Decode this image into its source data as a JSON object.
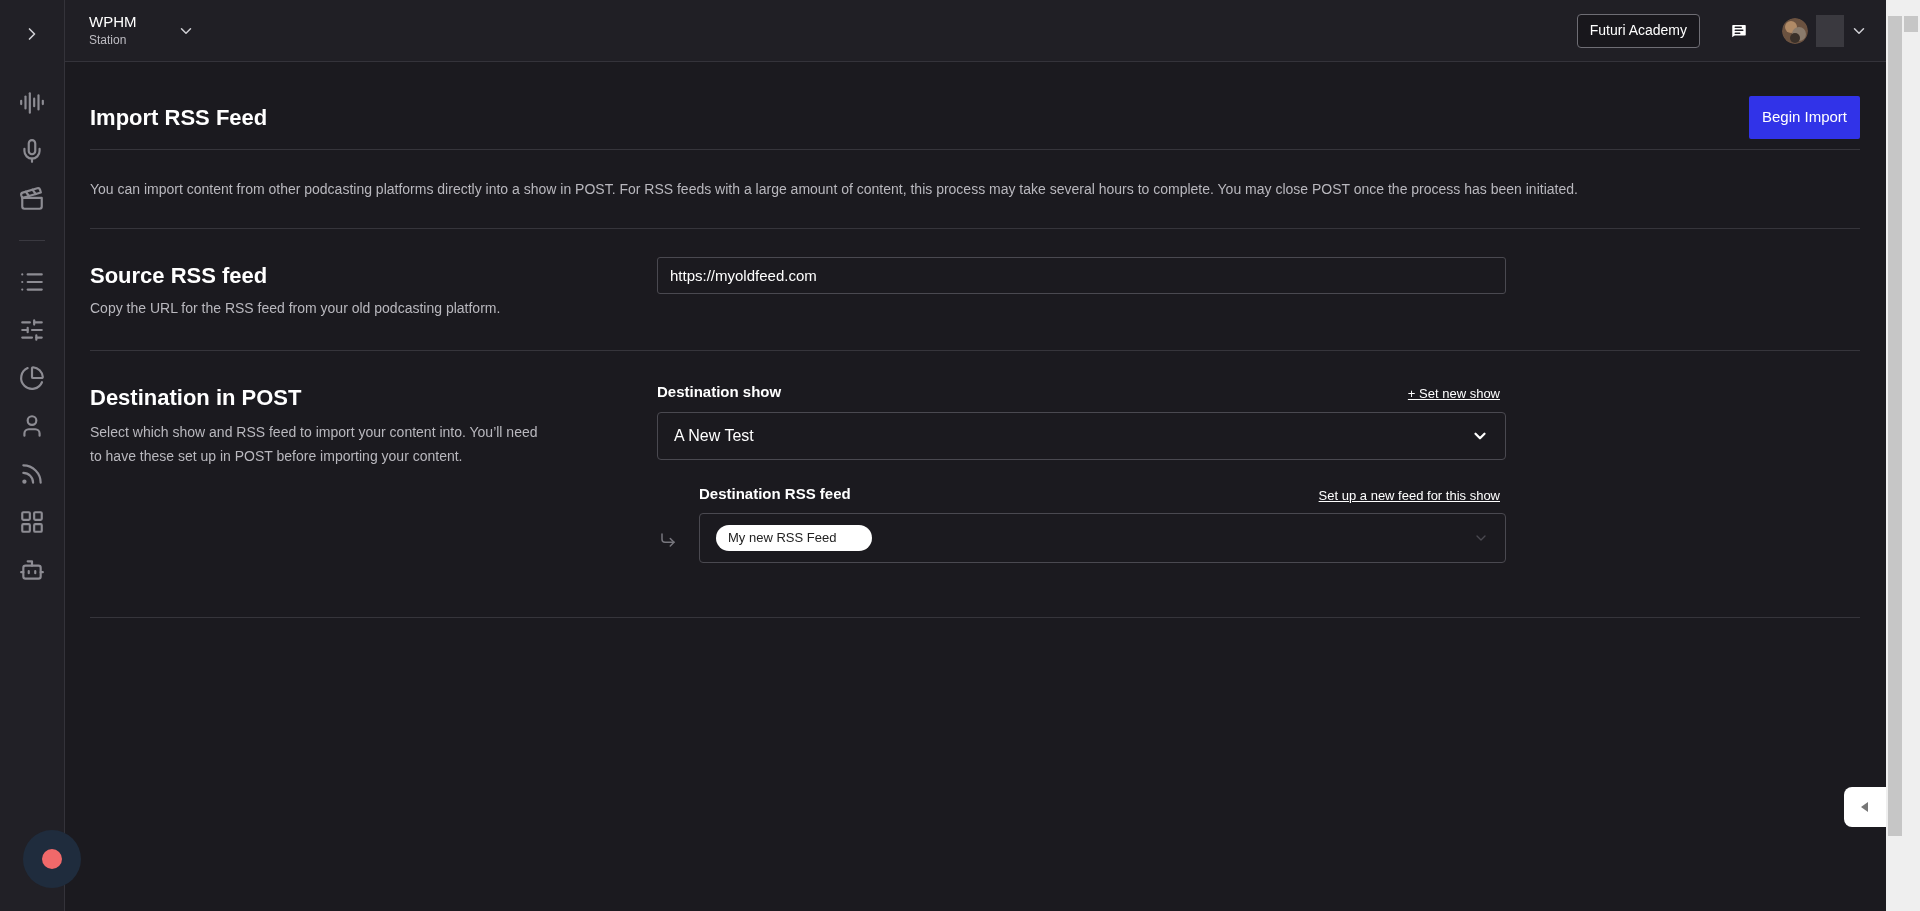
{
  "header": {
    "station_name": "WPHM",
    "station_type": "Station",
    "academy_button": "Futuri Academy"
  },
  "page": {
    "title": "Import RSS Feed",
    "primary_button": "Begin Import",
    "description": "You can import content from other podcasting platforms directly into a show in POST. For RSS feeds with a large amount of content, this process may take several hours to complete. You may close POST once the process has been initiated."
  },
  "source": {
    "heading": "Source RSS feed",
    "hint": "Copy the URL for the RSS feed from your old podcasting platform.",
    "value": "https://myoldfeed.com"
  },
  "destination": {
    "heading": "Destination in POST",
    "hint": "Select which show and RSS feed to import your content into. You’ll need to have these set up in POST before importing your content.",
    "show_label": "Destination show",
    "show_link": "+ Set new show",
    "show_value": "A New Test",
    "feed_label": "Destination RSS feed",
    "feed_link": "Set up a new feed for this show",
    "feed_chip": "My new RSS Feed"
  }
}
